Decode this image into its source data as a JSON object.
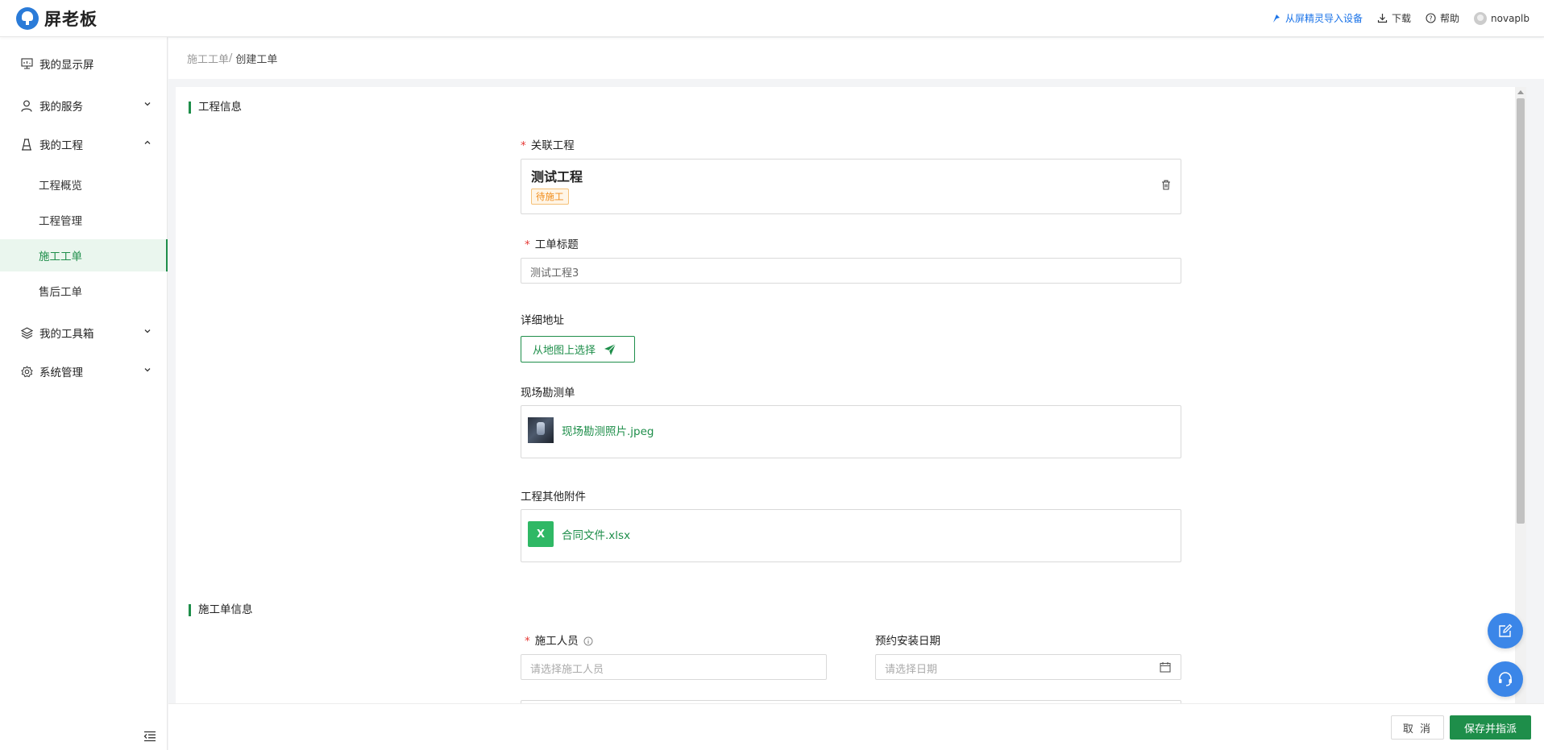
{
  "header": {
    "logo_text": "屏老板",
    "import_link": "从屏精灵导入设备",
    "download": "下载",
    "help": "帮助",
    "username": "novaplb"
  },
  "sidebar": {
    "items": [
      {
        "label": "我的显示屏",
        "icon": "monitor-icon"
      },
      {
        "label": "我的服务",
        "icon": "user-icon"
      },
      {
        "label": "我的工程",
        "icon": "project-icon"
      },
      {
        "label": "我的工具箱",
        "icon": "layers-icon"
      },
      {
        "label": "系统管理",
        "icon": "gear-icon"
      }
    ],
    "sub_items": [
      {
        "label": "工程概览"
      },
      {
        "label": "工程管理"
      },
      {
        "label": "施工工单",
        "active": true
      },
      {
        "label": "售后工单"
      }
    ]
  },
  "breadcrumb": {
    "parent": "施工工单",
    "separator": "/",
    "current": "创建工单"
  },
  "sections": {
    "project_info": "工程信息",
    "order_info": "施工单信息"
  },
  "form": {
    "linked_project": {
      "label": "关联工程",
      "name": "测试工程",
      "status": "待施工"
    },
    "order_title": {
      "label": "工单标题",
      "value": "测试工程3"
    },
    "address": {
      "label": "详细地址",
      "button": "从地图上选择"
    },
    "survey": {
      "label": "现场勘测单",
      "file": "现场勘测照片.jpeg"
    },
    "attachments": {
      "label": "工程其他附件",
      "file": "合同文件.xlsx",
      "file_icon_text": "X"
    },
    "workers": {
      "label": "施工人员",
      "placeholder": "请选择施工人员"
    },
    "install_date": {
      "label": "预约安装日期",
      "placeholder": "请选择日期"
    }
  },
  "footer": {
    "cancel": "取 消",
    "save": "保存并指派"
  },
  "colors": {
    "primary_green": "#1e8e4a",
    "link_blue": "#1a73e8",
    "float_blue": "#3b86e8",
    "tag_orange": "#f08c1a"
  }
}
